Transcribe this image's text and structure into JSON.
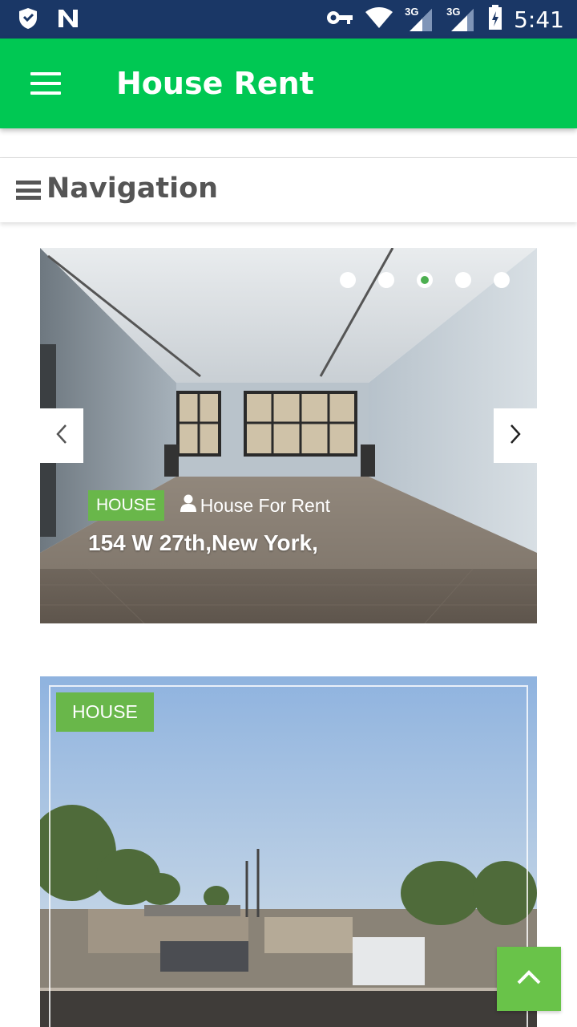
{
  "status_bar": {
    "time": "5:41",
    "network_1": "3G",
    "network_2": "3G",
    "icons": [
      "shield-icon",
      "n-icon",
      "key-icon",
      "wifi-icon",
      "signal-icon",
      "signal-icon",
      "battery-icon"
    ]
  },
  "app_bar": {
    "title": "House Rent",
    "menu_icon": "hamburger-menu-icon"
  },
  "navigation": {
    "label": "Navigation",
    "icon": "bars-icon"
  },
  "slider": {
    "slide_count": 5,
    "active_index": 2,
    "tag": "HOUSE",
    "type": "House For Rent",
    "address": "154 W 27th,New York,",
    "prev_icon": "chevron-left-icon",
    "next_icon": "chevron-right-icon"
  },
  "listing": {
    "tag": "HOUSE"
  },
  "colors": {
    "status_bar": "#1a3766",
    "app_bar": "#00c853",
    "tag": "#69b74a",
    "fab": "#69c349"
  },
  "fab": {
    "icon": "chevron-up-icon"
  }
}
